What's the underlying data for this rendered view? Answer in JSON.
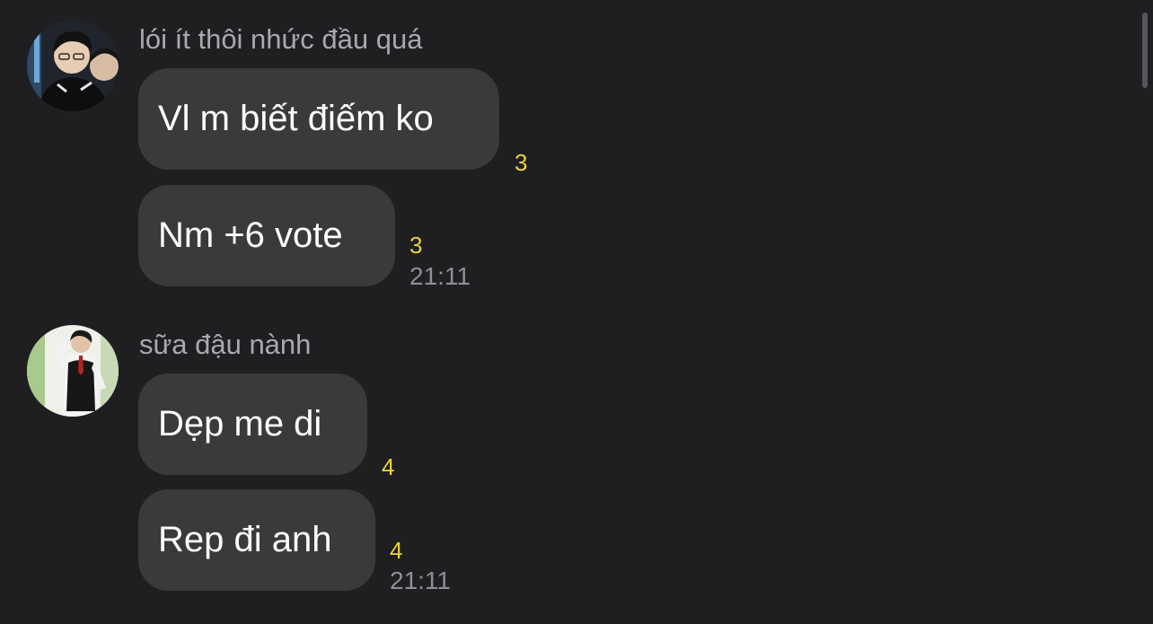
{
  "groups": [
    {
      "sender": "lói ít thôi nhức đầu quá",
      "messages": [
        {
          "text": "Vl m biết điếm ko",
          "count": "3",
          "time": ""
        },
        {
          "text": "Nm +6 vote",
          "count": "3",
          "time": "21:11"
        }
      ]
    },
    {
      "sender": "sữa đậu nành",
      "messages": [
        {
          "text": "Dẹp me di",
          "count": "4",
          "time": ""
        },
        {
          "text": "Rep đi anh",
          "count": "4",
          "time": "21:11"
        }
      ]
    }
  ],
  "colors": {
    "background": "#1f1f21",
    "bubble": "#3a3a3c",
    "counter": "#e9d33a",
    "timestamp": "#8e8e93",
    "sender": "#a9a9ad"
  }
}
